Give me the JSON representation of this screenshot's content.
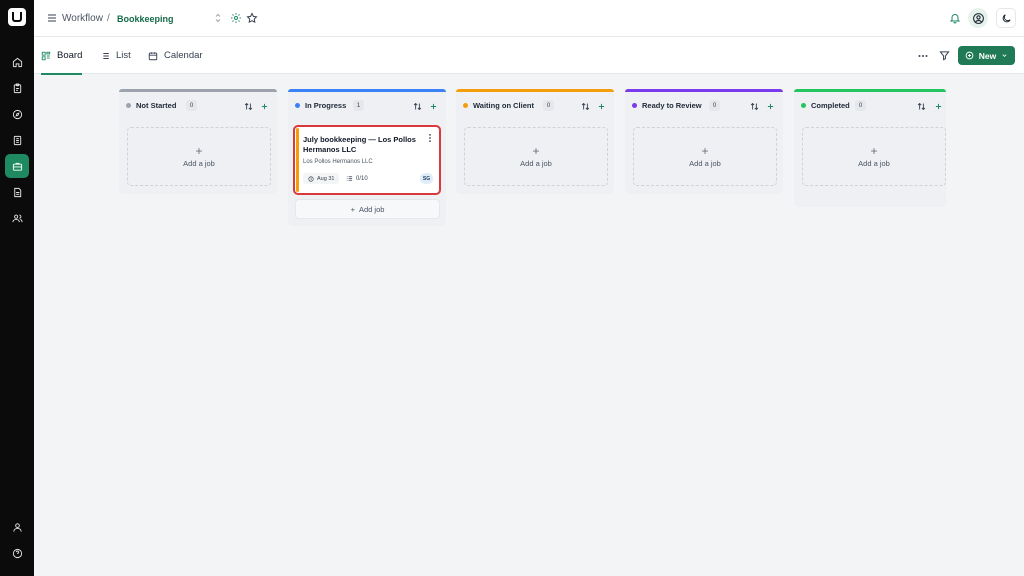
{
  "app": {
    "breadcrumb": {
      "root": "Workflow",
      "separator": "/",
      "current": "Bookkeeping"
    }
  },
  "sidebar": {
    "items": [
      {
        "icon": "home-icon"
      },
      {
        "icon": "clipboard-icon"
      },
      {
        "icon": "compass-icon"
      },
      {
        "icon": "document-icon"
      },
      {
        "icon": "briefcase-icon",
        "active": true
      },
      {
        "icon": "file-text-icon"
      },
      {
        "icon": "users-icon"
      }
    ],
    "bottom": [
      {
        "icon": "user-icon"
      },
      {
        "icon": "help-icon"
      }
    ]
  },
  "tabs": [
    {
      "label": "Board",
      "icon": "board-icon",
      "active": true
    },
    {
      "label": "List",
      "icon": "list-icon"
    },
    {
      "label": "Calendar",
      "icon": "calendar-icon"
    }
  ],
  "toolbar": {
    "new_label": "New"
  },
  "board": {
    "add_job_label": "Add a job",
    "add_job_button_label": "Add job",
    "columns": [
      {
        "title": "Not Started",
        "count": "0",
        "color": "#9ca3af"
      },
      {
        "title": "In Progress",
        "count": "1",
        "color": "#3b82f6"
      },
      {
        "title": "Waiting on Client",
        "count": "0",
        "color": "#f59e0b"
      },
      {
        "title": "Ready to Review",
        "count": "0",
        "color": "#7c3aed"
      },
      {
        "title": "Completed",
        "count": "0",
        "color": "#22c55e"
      }
    ],
    "job": {
      "title": "July bookkeeping — Los Pollos Hermanos LLC",
      "client": "Los Pollos Hermanos LLC",
      "due": "Aug 31",
      "tasks": "0/10",
      "assignee": "SG"
    }
  },
  "colors": {
    "brand": "#1f7a55",
    "selected_border": "#d9393c"
  }
}
